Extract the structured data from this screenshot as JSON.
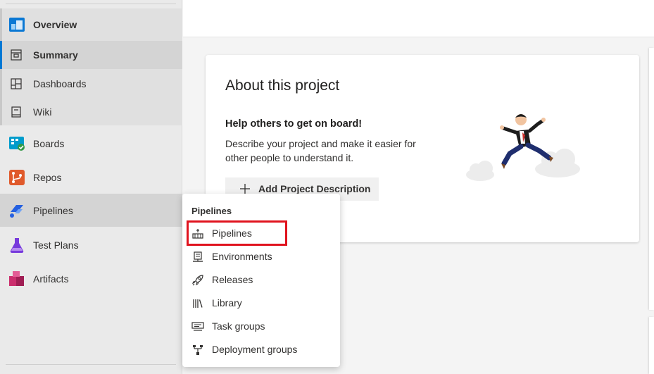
{
  "sidebar": {
    "overview": {
      "label": "Overview",
      "icon": "overview-icon"
    },
    "sub_items": [
      {
        "label": "Summary",
        "icon": "summary-icon",
        "selected": true
      },
      {
        "label": "Dashboards",
        "icon": "dashboards-icon"
      },
      {
        "label": "Wiki",
        "icon": "wiki-icon"
      }
    ],
    "items": [
      {
        "label": "Boards",
        "icon": "boards-icon",
        "color": "#009ccc"
      },
      {
        "label": "Repos",
        "icon": "repos-icon",
        "color": "#e05a2b"
      },
      {
        "label": "Pipelines",
        "icon": "pipelines-icon",
        "color": "#2560e0"
      },
      {
        "label": "Test Plans",
        "icon": "test-plans-icon",
        "color": "#773adc"
      },
      {
        "label": "Artifacts",
        "icon": "artifacts-icon",
        "color": "#cb2e6d"
      }
    ]
  },
  "about": {
    "title": "About this project",
    "subtitle": "Help others to get on board!",
    "description": "Describe your project and make it easier for other people to understand it.",
    "add_button_label": "Add Project Description"
  },
  "flyout": {
    "title": "Pipelines",
    "items": [
      {
        "label": "Pipelines",
        "icon": "pipelines-icon",
        "highlighted": true
      },
      {
        "label": "Environments",
        "icon": "environments-icon"
      },
      {
        "label": "Releases",
        "icon": "rocket-icon"
      },
      {
        "label": "Library",
        "icon": "library-icon"
      },
      {
        "label": "Task groups",
        "icon": "task-groups-icon"
      },
      {
        "label": "Deployment groups",
        "icon": "deployment-groups-icon"
      }
    ]
  },
  "colors": {
    "accent": "#0078d4",
    "highlight": "#e0131e"
  }
}
